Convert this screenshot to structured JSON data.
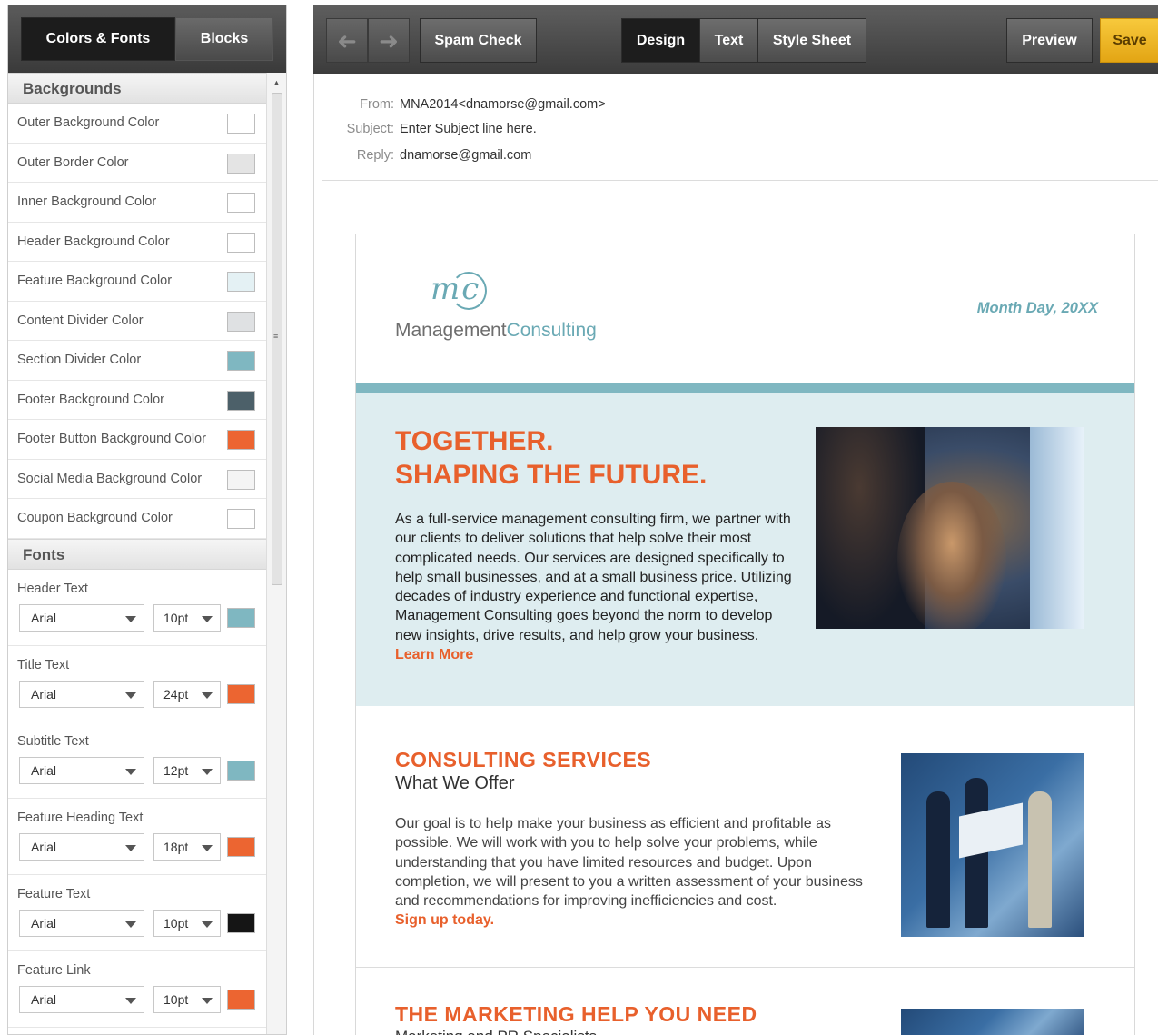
{
  "left_panel": {
    "tabs": [
      "Colors & Fonts",
      "Blocks"
    ],
    "backgrounds_heading": "Backgrounds",
    "colors": [
      {
        "label": "Outer Background Color",
        "color": "#ffffff"
      },
      {
        "label": "Outer Border Color",
        "color": "#e4e4e4"
      },
      {
        "label": "Inner Background Color",
        "color": "#ffffff"
      },
      {
        "label": "Header Background Color",
        "color": "#ffffff"
      },
      {
        "label": "Feature Background Color",
        "color": "#e4f1f4"
      },
      {
        "label": "Content Divider Color",
        "color": "#dfe1e3"
      },
      {
        "label": "Section Divider Color",
        "color": "#7fb7c1"
      },
      {
        "label": "Footer Background Color",
        "color": "#4c6069"
      },
      {
        "label": "Footer Button Background Color",
        "color": "#ec6531"
      },
      {
        "label": "Social Media Background Color",
        "color": "#f4f4f4"
      },
      {
        "label": "Coupon Background Color",
        "color": "#ffffff"
      }
    ],
    "fonts_heading": "Fonts",
    "fonts": [
      {
        "label": "Header Text",
        "family": "Arial",
        "size": "10pt",
        "color": "#7fb7c1"
      },
      {
        "label": "Title Text",
        "family": "Arial",
        "size": "24pt",
        "color": "#ec6531"
      },
      {
        "label": "Subtitle Text",
        "family": "Arial",
        "size": "12pt",
        "color": "#7fb7c1"
      },
      {
        "label": "Feature Heading Text",
        "family": "Arial",
        "size": "18pt",
        "color": "#ec6531"
      },
      {
        "label": "Feature Text",
        "family": "Arial",
        "size": "10pt",
        "color": "#151515"
      },
      {
        "label": "Feature Link",
        "family": "Arial",
        "size": "10pt",
        "color": "#ec6531"
      }
    ]
  },
  "toolbar": {
    "spam_check": "Spam Check",
    "design": "Design",
    "text": "Text",
    "style_sheet": "Style Sheet",
    "preview": "Preview",
    "save": "Save"
  },
  "mail": {
    "from_label": "From:",
    "from_value": "MNA2014<dnamorse@gmail.com>",
    "subject_label": "Subject:",
    "subject_value": "Enter Subject line here.",
    "reply_label": "Reply:",
    "reply_value": "dnamorse@gmail.com"
  },
  "email": {
    "logo_mark": "mc",
    "logo_word1": "Management",
    "logo_word2": "Consulting",
    "date": "Month Day, 20XX",
    "feature": {
      "title_line1": "TOGETHER.",
      "title_line2": "SHAPING THE FUTURE.",
      "body": "As a full-service management consulting firm, we partner with our clients to deliver solutions that help solve their most complicated needs. Our services are designed specifically to help small businesses, and at a small business price. Utilizing decades of industry experience and functional expertise, Management Consulting goes beyond the norm to develop new insights, drive results, and help grow your business.",
      "link": "Learn More"
    },
    "section1": {
      "title": "CONSULTING SERVICES",
      "subtitle": "What We Offer",
      "body": "Our goal is to help make your business as efficient and profitable as possible. We will work with you to help solve your problems, while understanding that you have limited resources and budget. Upon completion, we will present to you a written assessment of your business and recommendations for improving inefficiencies and cost.",
      "link": "Sign up today."
    },
    "section2": {
      "title": "THE MARKETING HELP YOU NEED",
      "subtitle": "Marketing and PR Specialists"
    }
  }
}
